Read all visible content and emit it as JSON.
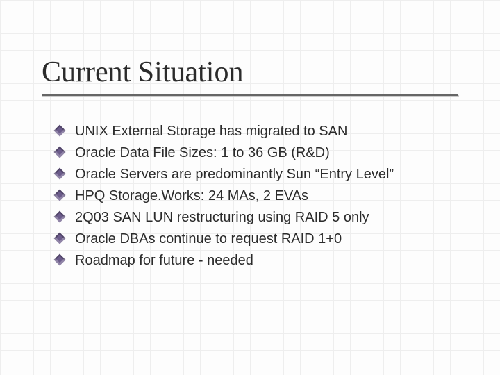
{
  "slide": {
    "title": "Current Situation",
    "bullets": [
      "UNIX External Storage has migrated to SAN",
      "Oracle Data File Sizes: 1 to 36 GB (R&D)",
      "Oracle Servers are predominantly Sun “Entry Level”",
      "HPQ Storage.Works: 24 MAs, 2 EVAs",
      "2Q03 SAN LUN restructuring using RAID 5 only",
      "Oracle DBAs continue to request RAID 1+0",
      "Roadmap for future - needed"
    ]
  }
}
